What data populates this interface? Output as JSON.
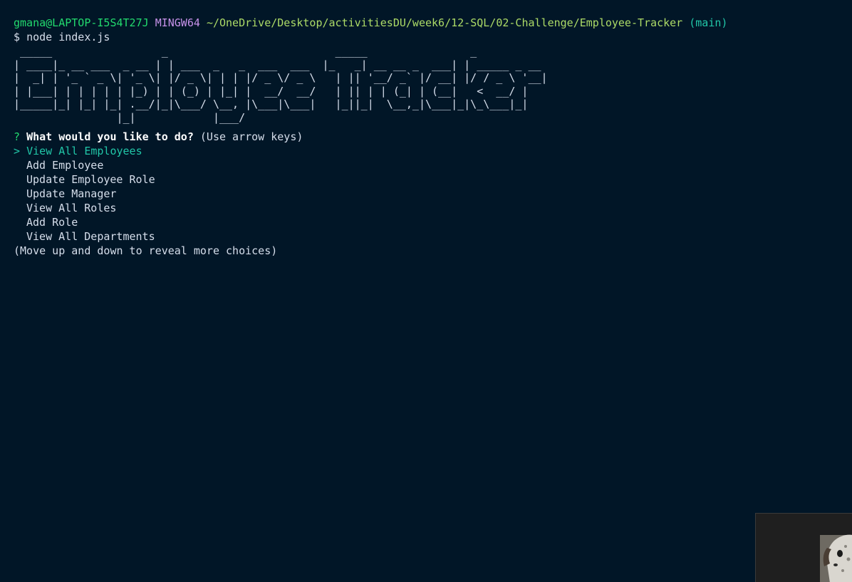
{
  "prompt": {
    "user_host": "gmana@LAPTOP-I5S4T27J",
    "system": "MINGW64",
    "path": "~/OneDrive/Desktop/activitiesDU/week6/12-SQL/02-Challenge/Employee-Tracker",
    "branch": "(main)",
    "symbol": "$",
    "command": "node index.js"
  },
  "banner": {
    "text": "Employee Tracker"
  },
  "question": {
    "mark": "?",
    "text": "What would you like to do?",
    "hint": "(Use arrow keys)"
  },
  "menu": {
    "pointer": ">",
    "items": [
      "View All Employees",
      "Add Employee",
      "Update Employee Role",
      "Update Manager",
      "View All Roles",
      "Add Role",
      "View All Departments"
    ],
    "selected_index": 0
  },
  "footer": {
    "hint": "(Move up and down to reveal more choices)"
  },
  "colors": {
    "background": "#011627",
    "user_host": "#22da6e",
    "system": "#c792ea",
    "path": "#addb67",
    "branch": "#21c7a8",
    "selected": "#21c7a8"
  },
  "icons": {
    "thumbnail": "dog-webcam-thumbnail"
  }
}
